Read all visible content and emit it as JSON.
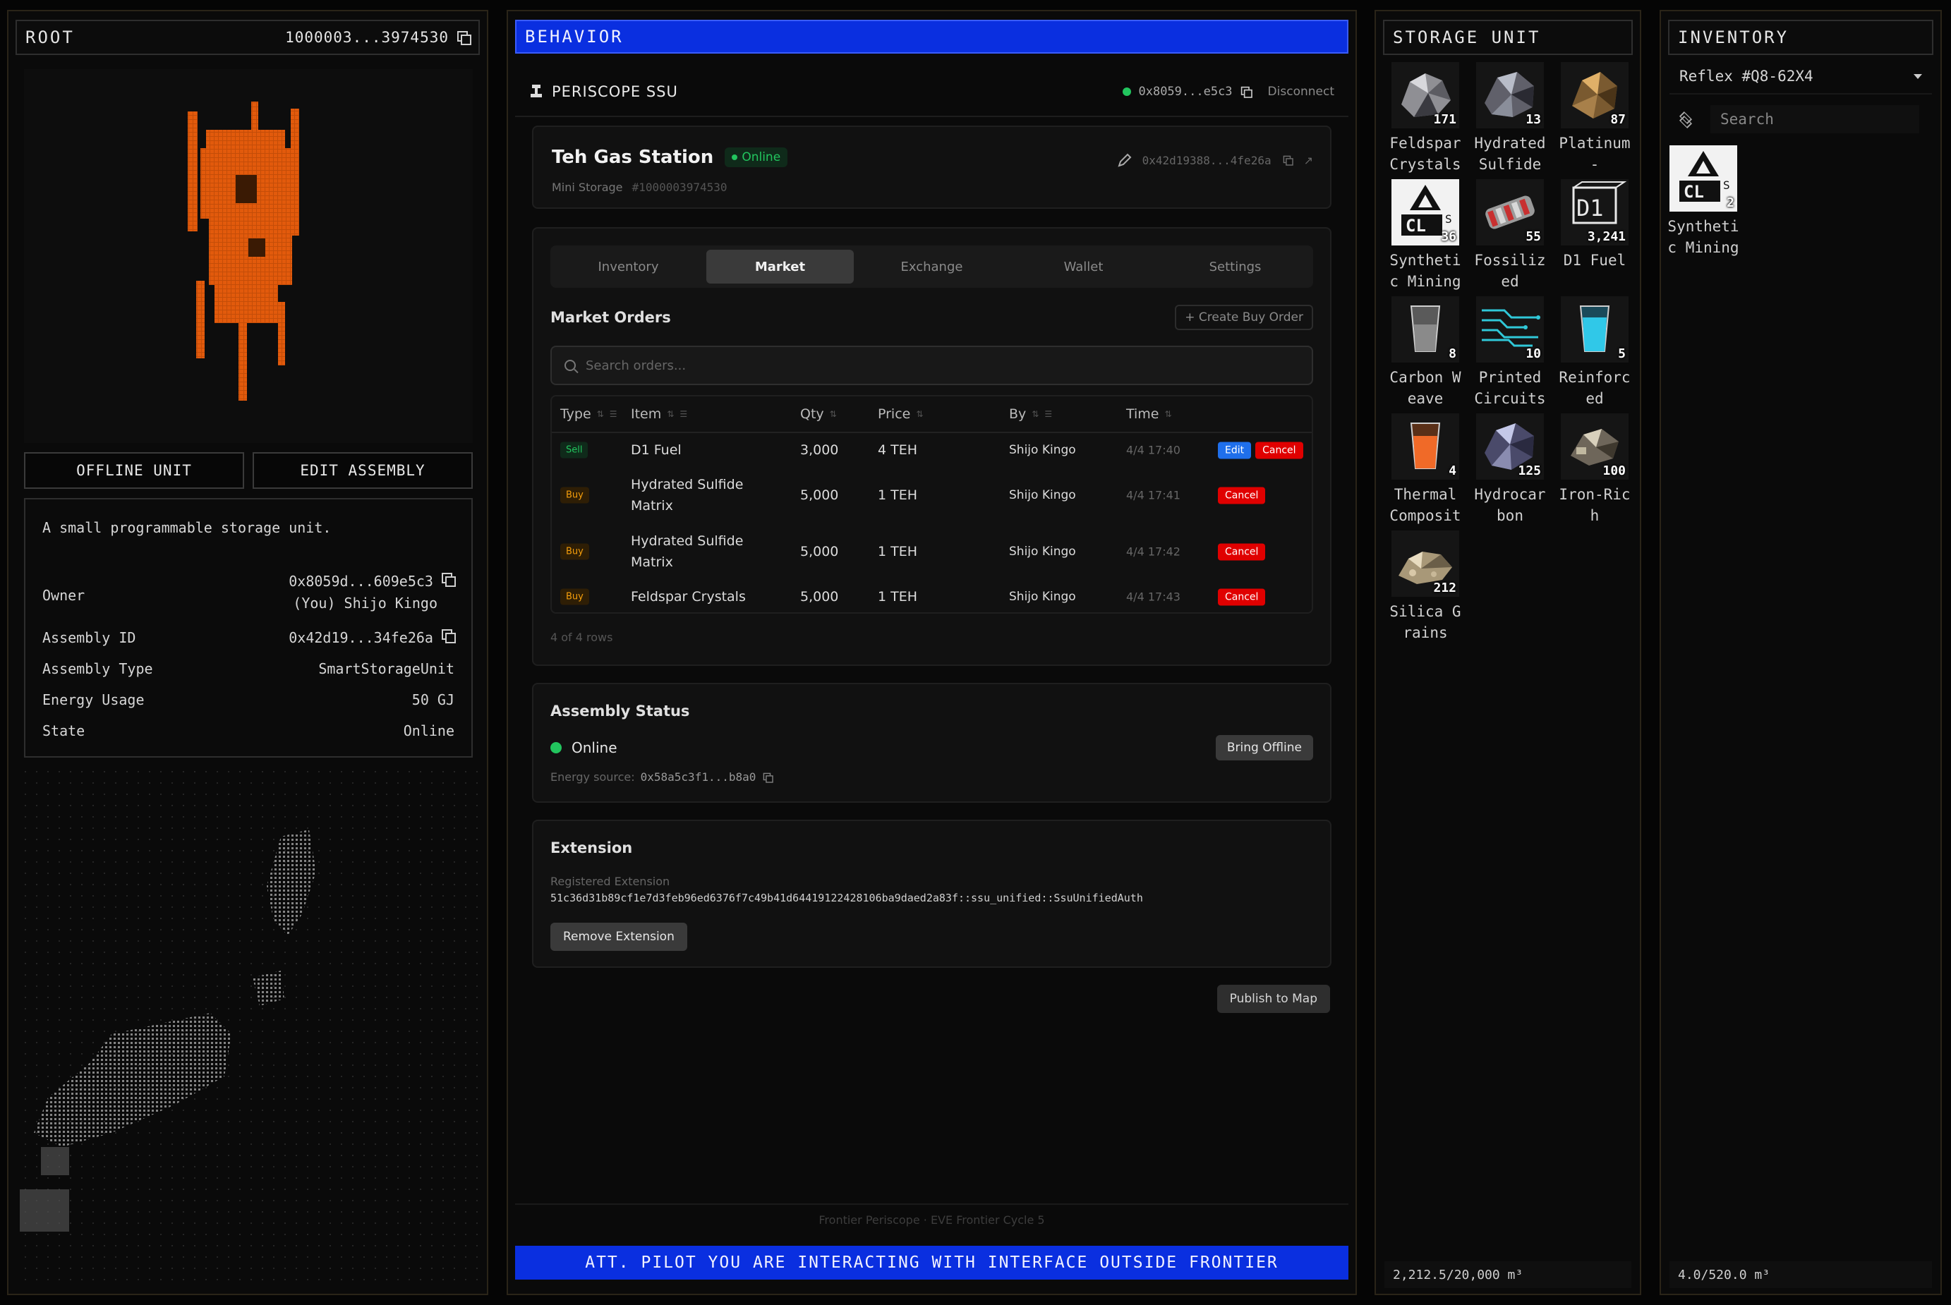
{
  "root": {
    "title": "ROOT",
    "id": "1000003...3974530",
    "buttons": {
      "offline": "OFFLINE UNIT",
      "edit": "EDIT ASSEMBLY"
    },
    "description": "A small programmable storage unit.",
    "owner_label": "Owner",
    "owner_addr": "0x8059d...609e5c3",
    "owner_name": "(You) Shijo Kingo",
    "assembly_id_label": "Assembly ID",
    "assembly_id": "0x42d19...34fe26a",
    "type_label": "Assembly Type",
    "type": "SmartStorageUnit",
    "energy_label": "Energy Usage",
    "energy": "50 GJ",
    "state_label": "State",
    "state": "Online"
  },
  "behavior": {
    "title": "BEHAVIOR",
    "app_name": "PERISCOPE SSU",
    "wallet": "0x8059...e5c3",
    "disconnect": "Disconnect",
    "station": {
      "name": "Teh Gas Station",
      "status": "Online",
      "kind": "Mini Storage",
      "id": "#1000003974530",
      "addr": "0x42d19388...4fe26a"
    },
    "tabs": [
      "Inventory",
      "Market",
      "Exchange",
      "Wallet",
      "Settings"
    ],
    "market": {
      "title": "Market Orders",
      "create": "+ Create Buy Order",
      "search_placeholder": "Search orders...",
      "columns": [
        "Type",
        "Item",
        "Qty",
        "Price",
        "By",
        "Time"
      ],
      "rows": [
        {
          "type": "Sell",
          "item": "D1 Fuel",
          "qty": "3,000",
          "price": "4 TEH",
          "by": "Shijo Kingo",
          "time": "4/4 17:40",
          "edit": "Edit",
          "cancel": "Cancel"
        },
        {
          "type": "Buy",
          "item": "Hydrated Sulfide Matrix",
          "qty": "5,000",
          "price": "1 TEH",
          "by": "Shijo Kingo",
          "time": "4/4 17:41",
          "cancel": "Cancel"
        },
        {
          "type": "Buy",
          "item": "Hydrated Sulfide Matrix",
          "qty": "5,000",
          "price": "1 TEH",
          "by": "Shijo Kingo",
          "time": "4/4 17:42",
          "cancel": "Cancel"
        },
        {
          "type": "Buy",
          "item": "Feldspar Crystals",
          "qty": "5,000",
          "price": "1 TEH",
          "by": "Shijo Kingo",
          "time": "4/4 17:43",
          "cancel": "Cancel"
        }
      ],
      "rows_count": "4 of 4 rows"
    },
    "status": {
      "title": "Assembly Status",
      "state": "Online",
      "bring_offline": "Bring Offline",
      "energy_label": "Energy source:",
      "energy_addr": "0x58a5c3f1...b8a0"
    },
    "extension": {
      "title": "Extension",
      "label": "Registered Extension",
      "value": "51c36d31b89cf1e7d3feb96ed6376f7c49b41d64419122428106ba9daed2a83f::ssu_unified::SsuUnifiedAuth",
      "remove": "Remove Extension"
    },
    "publish": "Publish to Map",
    "footer": "Frontier Periscope · EVE Frontier Cycle 5",
    "warning": "ATT. PILOT YOU ARE INTERACTING WITH INTERFACE OUTSIDE FRONTIER"
  },
  "storage": {
    "title": "STORAGE UNIT",
    "items": [
      {
        "name": "Feldspar Crystals",
        "qty": "171",
        "icon": "ore-grey"
      },
      {
        "name": "Hydrated Sulfide",
        "qty": "13",
        "icon": "ore-dark"
      },
      {
        "name": "Platinum -",
        "qty": "87",
        "icon": "ore-gold"
      },
      {
        "name": "Synthetic Mining",
        "qty": "36",
        "icon": "synthetic-mining"
      },
      {
        "name": "Fossilized",
        "qty": "55",
        "icon": "fossil"
      },
      {
        "name": "D1 Fuel",
        "qty": "3,241",
        "icon": "d1-fuel"
      },
      {
        "name": "Carbon Weave",
        "qty": "8",
        "icon": "beaker-grey"
      },
      {
        "name": "Printed Circuits",
        "qty": "10",
        "icon": "circuit"
      },
      {
        "name": "Reinforced",
        "qty": "5",
        "icon": "beaker-cyan"
      },
      {
        "name": "Thermal Composit",
        "qty": "4",
        "icon": "beaker-orange"
      },
      {
        "name": "Hydrocarbon",
        "qty": "125",
        "icon": "ore-purple"
      },
      {
        "name": "Iron-Rich",
        "qty": "100",
        "icon": "ore-iron"
      },
      {
        "name": "Silica Grains",
        "qty": "212",
        "icon": "ore-sand"
      }
    ],
    "capacity": "2,212.5/20,000 m³"
  },
  "inventory": {
    "title": "INVENTORY",
    "selected": "Reflex #Q8-62X4",
    "search_placeholder": "Search",
    "item": {
      "name": "Synthetic Mining",
      "qty": "2",
      "icon": "synthetic-mining"
    },
    "capacity": "4.0/520.0 m³"
  },
  "colors": {
    "accent_blue": "#0a2fe0",
    "online_green": "#22c55e",
    "cancel_red": "#e00000",
    "edit_blue": "#1f6feb",
    "assembly_orange": "#e0560a"
  }
}
